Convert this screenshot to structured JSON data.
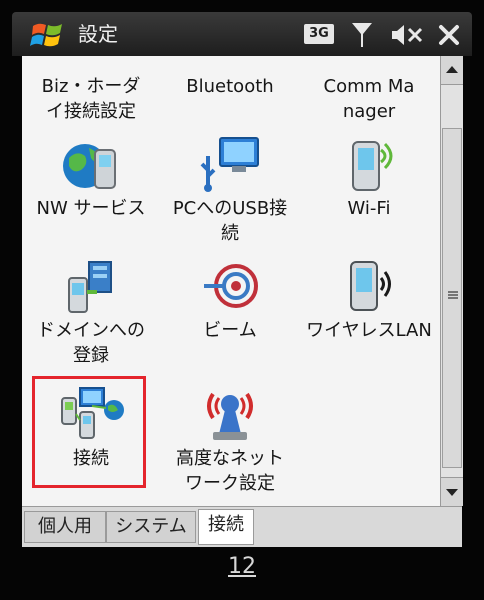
{
  "window": {
    "title": "設定"
  },
  "statusbar": {
    "network": "3G"
  },
  "items": [
    {
      "label": "Biz・ホーダイ接続設定"
    },
    {
      "label": "Bluetooth"
    },
    {
      "label": "Comm Manager"
    },
    {
      "label": "NW サービス"
    },
    {
      "label": "PCへのUSB接続"
    },
    {
      "label": "Wi-Fi"
    },
    {
      "label": "ドメインへの登録"
    },
    {
      "label": "ビーム"
    },
    {
      "label": "ワイヤレスLAN"
    },
    {
      "label": "接続"
    },
    {
      "label": "高度なネットワーク設定"
    }
  ],
  "tabs": [
    {
      "label": "個人用"
    },
    {
      "label": "システム"
    },
    {
      "label": "接続"
    }
  ],
  "page_number": "12",
  "colors": {
    "highlight": "#e4242c"
  }
}
